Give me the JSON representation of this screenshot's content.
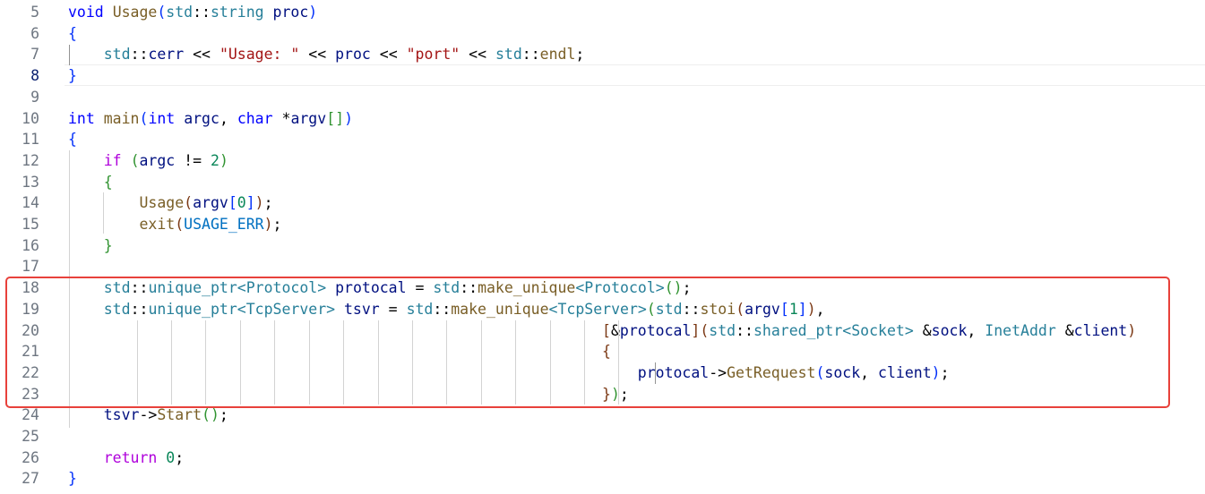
{
  "editor": {
    "current_line": 8,
    "lines": [
      {
        "n": "5",
        "tokens": [
          [
            "kw",
            "void"
          ],
          [
            "op",
            " "
          ],
          [
            "fn",
            "Usage"
          ],
          [
            "br1",
            "("
          ],
          [
            "ns",
            "std"
          ],
          [
            "op",
            "::"
          ],
          [
            "ty",
            "string"
          ],
          [
            "op",
            " "
          ],
          [
            "var",
            "proc"
          ],
          [
            "br1",
            ")"
          ]
        ]
      },
      {
        "n": "6",
        "tokens": [
          [
            "br1",
            "{"
          ]
        ]
      },
      {
        "n": "7",
        "tokens": [
          [
            "op",
            "    "
          ],
          [
            "ns",
            "std"
          ],
          [
            "op",
            "::"
          ],
          [
            "var",
            "cerr"
          ],
          [
            "op",
            " << "
          ],
          [
            "str",
            "\"Usage: \""
          ],
          [
            "op",
            " << "
          ],
          [
            "var",
            "proc"
          ],
          [
            "op",
            " << "
          ],
          [
            "str",
            "\"port\""
          ],
          [
            "op",
            " << "
          ],
          [
            "ns",
            "std"
          ],
          [
            "op",
            "::"
          ],
          [
            "fn",
            "endl"
          ],
          [
            "op",
            ";"
          ]
        ]
      },
      {
        "n": "8",
        "tokens": [
          [
            "br1",
            "}"
          ]
        ]
      },
      {
        "n": "9",
        "tokens": []
      },
      {
        "n": "10",
        "tokens": [
          [
            "kw",
            "int"
          ],
          [
            "op",
            " "
          ],
          [
            "fn",
            "main"
          ],
          [
            "br1",
            "("
          ],
          [
            "kw",
            "int"
          ],
          [
            "op",
            " "
          ],
          [
            "var",
            "argc"
          ],
          [
            "op",
            ", "
          ],
          [
            "kw",
            "char"
          ],
          [
            "op",
            " *"
          ],
          [
            "var",
            "argv"
          ],
          [
            "br2",
            "[]"
          ],
          [
            "br1",
            ")"
          ]
        ]
      },
      {
        "n": "11",
        "tokens": [
          [
            "br1",
            "{"
          ]
        ]
      },
      {
        "n": "12",
        "tokens": [
          [
            "op",
            "    "
          ],
          [
            "ctl",
            "if"
          ],
          [
            "op",
            " "
          ],
          [
            "br2",
            "("
          ],
          [
            "var",
            "argc"
          ],
          [
            "op",
            " != "
          ],
          [
            "num",
            "2"
          ],
          [
            "br2",
            ")"
          ]
        ]
      },
      {
        "n": "13",
        "tokens": [
          [
            "op",
            "    "
          ],
          [
            "br2",
            "{"
          ]
        ]
      },
      {
        "n": "14",
        "tokens": [
          [
            "op",
            "        "
          ],
          [
            "fn",
            "Usage"
          ],
          [
            "br3",
            "("
          ],
          [
            "var",
            "argv"
          ],
          [
            "br1",
            "["
          ],
          [
            "num",
            "0"
          ],
          [
            "br1",
            "]"
          ],
          [
            "br3",
            ")"
          ],
          [
            "op",
            ";"
          ]
        ]
      },
      {
        "n": "15",
        "tokens": [
          [
            "op",
            "        "
          ],
          [
            "fn",
            "exit"
          ],
          [
            "br3",
            "("
          ],
          [
            "mac",
            "USAGE_ERR"
          ],
          [
            "br3",
            ")"
          ],
          [
            "op",
            ";"
          ]
        ]
      },
      {
        "n": "16",
        "tokens": [
          [
            "op",
            "    "
          ],
          [
            "br2",
            "}"
          ]
        ]
      },
      {
        "n": "17",
        "tokens": []
      },
      {
        "n": "18",
        "tokens": [
          [
            "op",
            "    "
          ],
          [
            "ns",
            "std"
          ],
          [
            "op",
            "::"
          ],
          [
            "ty",
            "unique_ptr"
          ],
          [
            "ty",
            "<"
          ],
          [
            "ty",
            "Protocol"
          ],
          [
            "ty",
            ">"
          ],
          [
            "op",
            " "
          ],
          [
            "var",
            "protocal"
          ],
          [
            "op",
            " = "
          ],
          [
            "ns",
            "std"
          ],
          [
            "op",
            "::"
          ],
          [
            "fn",
            "make_unique"
          ],
          [
            "ty",
            "<"
          ],
          [
            "ty",
            "Protocol"
          ],
          [
            "ty",
            ">"
          ],
          [
            "br2",
            "()"
          ],
          [
            "op",
            ";"
          ]
        ]
      },
      {
        "n": "19",
        "tokens": [
          [
            "op",
            "    "
          ],
          [
            "ns",
            "std"
          ],
          [
            "op",
            "::"
          ],
          [
            "ty",
            "unique_ptr"
          ],
          [
            "ty",
            "<"
          ],
          [
            "ty",
            "TcpServer"
          ],
          [
            "ty",
            ">"
          ],
          [
            "op",
            " "
          ],
          [
            "var",
            "tsvr"
          ],
          [
            "op",
            " = "
          ],
          [
            "ns",
            "std"
          ],
          [
            "op",
            "::"
          ],
          [
            "fn",
            "make_unique"
          ],
          [
            "ty",
            "<"
          ],
          [
            "ty",
            "TcpServer"
          ],
          [
            "ty",
            ">"
          ],
          [
            "br2",
            "("
          ],
          [
            "ns",
            "std"
          ],
          [
            "op",
            "::"
          ],
          [
            "fn",
            "stoi"
          ],
          [
            "br3",
            "("
          ],
          [
            "var",
            "argv"
          ],
          [
            "br1",
            "["
          ],
          [
            "num",
            "1"
          ],
          [
            "br1",
            "]"
          ],
          [
            "br3",
            ")"
          ],
          [
            "op",
            ","
          ]
        ]
      },
      {
        "n": "20",
        "tokens": [
          [
            "op",
            "                                                            "
          ],
          [
            "br3",
            "["
          ],
          [
            "op",
            "&"
          ],
          [
            "var",
            "protocal"
          ],
          [
            "br3",
            "]"
          ],
          [
            "br3",
            "("
          ],
          [
            "ns",
            "std"
          ],
          [
            "op",
            "::"
          ],
          [
            "ty",
            "shared_ptr"
          ],
          [
            "ty",
            "<"
          ],
          [
            "ty",
            "Socket"
          ],
          [
            "ty",
            ">"
          ],
          [
            "op",
            " &"
          ],
          [
            "var",
            "sock"
          ],
          [
            "op",
            ", "
          ],
          [
            "ty",
            "InetAddr"
          ],
          [
            "op",
            " &"
          ],
          [
            "var",
            "client"
          ],
          [
            "br3",
            ")"
          ]
        ]
      },
      {
        "n": "21",
        "tokens": [
          [
            "op",
            "                                                            "
          ],
          [
            "br3",
            "{"
          ]
        ]
      },
      {
        "n": "22",
        "tokens": [
          [
            "op",
            "                                                                "
          ],
          [
            "var",
            "protocal"
          ],
          [
            "op",
            "->"
          ],
          [
            "fn",
            "GetRequest"
          ],
          [
            "br1",
            "("
          ],
          [
            "var",
            "sock"
          ],
          [
            "op",
            ", "
          ],
          [
            "var",
            "client"
          ],
          [
            "br1",
            ")"
          ],
          [
            "op",
            ";"
          ]
        ]
      },
      {
        "n": "23",
        "tokens": [
          [
            "op",
            "                                                            "
          ],
          [
            "br3",
            "}"
          ],
          [
            "br2",
            ")"
          ],
          [
            "op",
            ";"
          ]
        ]
      },
      {
        "n": "24",
        "tokens": [
          [
            "op",
            "    "
          ],
          [
            "var",
            "tsvr"
          ],
          [
            "op",
            "->"
          ],
          [
            "fn",
            "Start"
          ],
          [
            "br2",
            "()"
          ],
          [
            "op",
            ";"
          ]
        ]
      },
      {
        "n": "25",
        "tokens": []
      },
      {
        "n": "26",
        "tokens": [
          [
            "op",
            "    "
          ],
          [
            "ctl",
            "return"
          ],
          [
            "op",
            " "
          ],
          [
            "num",
            "0"
          ],
          [
            "op",
            ";"
          ]
        ]
      },
      {
        "n": "27",
        "tokens": [
          [
            "br1",
            "}"
          ]
        ]
      }
    ]
  },
  "colors": {
    "keyword": "#0000ff",
    "type": "#267f99",
    "function": "#795e26",
    "variable": "#001080",
    "string": "#a31515",
    "number": "#098658",
    "highlight_box": "#e8413b"
  }
}
